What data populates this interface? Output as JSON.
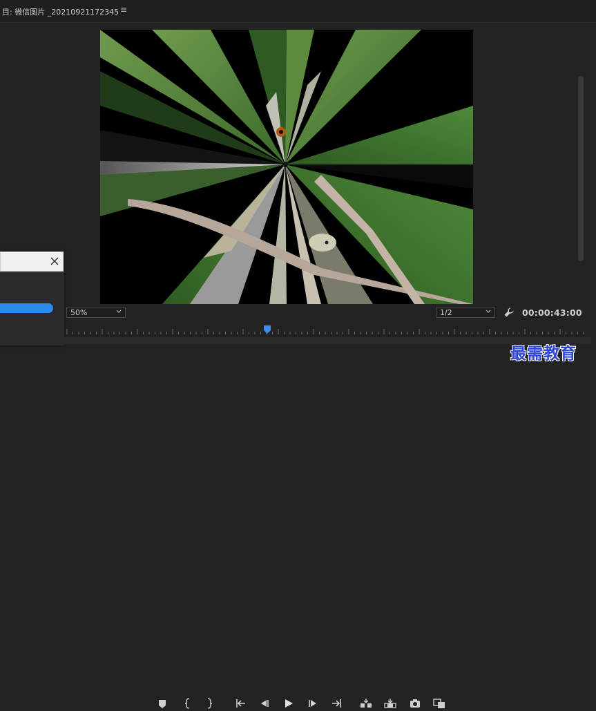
{
  "header": {
    "title": "目: 微信图片 _20210921172345",
    "menu_icon": "hamburger-menu-icon"
  },
  "viewer": {
    "zoom": "50%",
    "resolution": "1/2",
    "timecode": "00:00:43:00",
    "playhead_fraction": 0.385
  },
  "dialog": {
    "close_icon": "close-icon",
    "progress_fraction": 1
  },
  "transport": {
    "icons": [
      "add-marker-icon",
      "mark-in-icon",
      "mark-out-icon",
      "go-to-in-icon",
      "step-back-icon",
      "play-icon",
      "step-forward-icon",
      "go-to-out-icon",
      "insert-icon",
      "overwrite-icon",
      "export-frame-icon",
      "compare-view-icon"
    ]
  },
  "watermark": {
    "text": "最需教育"
  }
}
